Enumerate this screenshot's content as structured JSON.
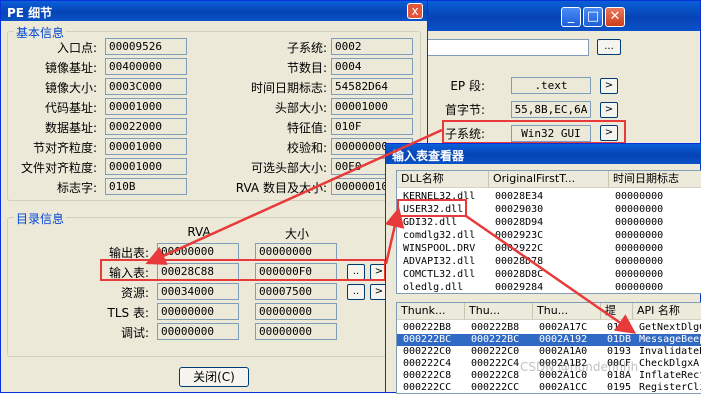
{
  "back_window": {
    "fields": {
      "ep_label": "EP 段:",
      "ep_value": ".text",
      "first_label": "首字节:",
      "first_value": "55,8B,EC,6A",
      "sub_label": "子系统:",
      "sub_value": "Win32 GUI"
    },
    "browse_label": "...",
    "arrow": ">"
  },
  "pe": {
    "title": "PE 细节",
    "close": "x",
    "basic_group": "基本信息",
    "basic_left": [
      {
        "label": "入口点:",
        "value": "00009526"
      },
      {
        "label": "镜像基址:",
        "value": "00400000"
      },
      {
        "label": "镜像大小:",
        "value": "0003C000"
      },
      {
        "label": "代码基址:",
        "value": "00001000"
      },
      {
        "label": "数据基址:",
        "value": "00022000"
      },
      {
        "label": "节对齐粒度:",
        "value": "00001000"
      },
      {
        "label": "文件对齐粒度:",
        "value": "00001000"
      },
      {
        "label": "标志字:",
        "value": "010B"
      }
    ],
    "basic_right": [
      {
        "label": "子系统:",
        "value": "0002"
      },
      {
        "label": "节数目:",
        "value": "0004"
      },
      {
        "label": "时间日期标志:",
        "value": "54582D64"
      },
      {
        "label": "头部大小:",
        "value": "00001000"
      },
      {
        "label": "特征值:",
        "value": "010F"
      },
      {
        "label": "校验和:",
        "value": "00000000"
      },
      {
        "label": "可选头部大小:",
        "value": "00E0"
      },
      {
        "label": "RVA 数目及大小:",
        "value": "00000010"
      }
    ],
    "dir_group": "目录信息",
    "col_rva": "RVA",
    "col_size": "大小",
    "dir_rows": [
      {
        "label": "输出表:",
        "rva": "00000000",
        "size": "00000000"
      },
      {
        "label": "输入表:",
        "rva": "00028C88",
        "size": "000000F0"
      },
      {
        "label": "资源:",
        "rva": "00034000",
        "size": "00007500"
      },
      {
        "label": "TLS 表:",
        "rva": "00000000",
        "size": "00000000"
      },
      {
        "label": "调试:",
        "rva": "00000000",
        "size": "00000000"
      }
    ],
    "close_button": "关闭(C)"
  },
  "imp": {
    "title": "输入表查看器",
    "dll_headers": [
      "DLL名称",
      "OriginalFirstT...",
      "时间日期标志"
    ],
    "dll_rows": [
      [
        "KERNEL32.dll",
        "00028E34",
        "00000000"
      ],
      [
        "USER32.dll",
        "00029030",
        "00000000"
      ],
      [
        "GDI32.dll",
        "00028D94",
        "00000000"
      ],
      [
        "comdlg32.dll",
        "0002923C",
        "00000000"
      ],
      [
        "WINSPOOL.DRV",
        "0002922C",
        "00000000"
      ],
      [
        "ADVAPI32.dll",
        "00028D78",
        "00000000"
      ],
      [
        "COMCTL32.dll",
        "00028D8C",
        "00000000"
      ],
      [
        "oledlg.dll",
        "00029284",
        "00000000"
      ]
    ],
    "api_headers": [
      "Thunk...",
      "Thu...",
      "Thu...",
      "提",
      "API 名称"
    ],
    "api_rows": [
      [
        "000222B8",
        "000222B8",
        "0002A17C",
        "0142",
        "GetNextDlgG"
      ],
      [
        "000222BC",
        "000222BC",
        "0002A192",
        "01DB",
        "MessageBeep"
      ],
      [
        "000222C0",
        "000222C0",
        "0002A1A0",
        "0193",
        "InvalidateR"
      ],
      [
        "000222C4",
        "000222C4",
        "0002A1B2",
        "00CF",
        "CheckDlgxA"
      ],
      [
        "000222C8",
        "000222C8",
        "0002A1C0",
        "018A",
        "InflateRect"
      ],
      [
        "000222CC",
        "000222CC",
        "0002A1CC",
        "0195",
        "RegisterCli"
      ]
    ],
    "selected_api_row": 1
  },
  "watermark": "CSDN @hundenhhh",
  "colors": {
    "highlight": "#e83a3a",
    "selection": "#316ac5",
    "title": "#0643b5",
    "group_title": "#0046d5"
  }
}
